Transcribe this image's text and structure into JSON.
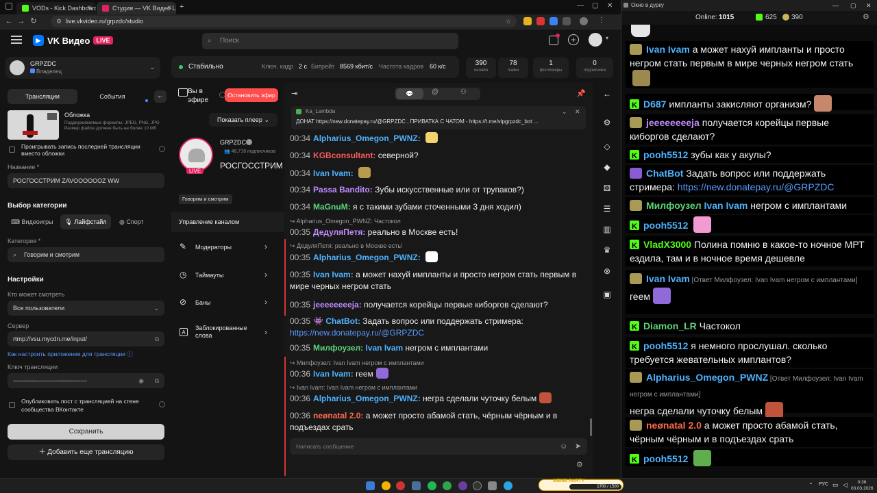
{
  "browser": {
    "tabs": [
      {
        "title": "VODs - Kick Dashboard"
      },
      {
        "title": "Студия — VK Видео Live"
      }
    ],
    "url": "live.vkvideo.ru/grpzdc/studio"
  },
  "vk": {
    "logo_text": "VK Видео",
    "live_badge": "LIVE",
    "search_placeholder": "Поиск",
    "channel": {
      "name": "GRPZDC",
      "role": "Владелец"
    },
    "left": {
      "tabs": [
        "Трансляции",
        "События"
      ],
      "cover_title": "Обложка",
      "cover_hint": "Поддерживаемые форматы: JPEG, PNG, JPG Размер файла должен быть не более 10 Мб",
      "replay_label": "Проигрывать запись последней трансляции вместо обложки",
      "name_label": "Название *",
      "name_value": "РОСГОССТРИМ ZAVOOOOOOZ WW",
      "category_section": "Выбор категории",
      "category_tabs": [
        "Видеоигры",
        "Лайфстайл",
        "Спорт"
      ],
      "category_label": "Категория *",
      "category_value": "Говорим и смотрим",
      "settings_section": "Настройки",
      "who_label": "Кто может смотреть",
      "who_value": "Все пользователи",
      "server_label": "Сервер",
      "server_value": "rtmp://vsu.mycdn.me/input/",
      "app_link": "Как настроить приложение для трансляции",
      "key_label": "Ключ трансляции",
      "key_value": "------------------------------------",
      "publish_label": "Опубликовать пост с трансляцией на стене сообщества ВКонтакте",
      "save_button": "Сохранить",
      "add_button": "Добавить еще трансляцию"
    },
    "status": {
      "state": "Стабильно",
      "keyframe_label": "Ключ. кадр",
      "keyframe_value": "2 с",
      "bitrate_label": "Битрейт",
      "bitrate_value": "8569 кбит/с",
      "fps_label": "Частота кадров",
      "fps_value": "60 к/с",
      "stats": [
        {
          "value": "390",
          "label": "онлайн"
        },
        {
          "value": "78",
          "label": "лайки"
        },
        {
          "value": "1",
          "label": "фолловеры"
        },
        {
          "value": "0",
          "label": "подписчики"
        }
      ]
    },
    "middle": {
      "on_air": "Вы в эфире",
      "stop_button": "Остановить эфир",
      "show_player": "Показать плеер",
      "channel_name": "GRPZDC",
      "subscribers": "48,716 подписчиков",
      "stream_title": "РОСГОССТРИМ ZAVOOOOOOZ WW",
      "live": "LIVE",
      "category_chip": "Говорим и смотрим",
      "manage_title": "Управление каналом",
      "menu": [
        "Модераторы",
        "Таймауты",
        "Баны",
        "Заблокированные слова"
      ]
    },
    "chat": {
      "pinned_author": "Ka_Lambda",
      "pinned_text": "ДОНАТ https://new.donatepay.ru/@GRPZDC , ПРИВАТКА С ЧАТОМ - https://t.me/vipgrpzdc_bot ...",
      "input_placeholder": "Написать сообщение",
      "messages": [
        {
          "time": "00:34",
          "author": "Alpharius_Omegon_PWNZ:",
          "text": "",
          "color": "#4fb3ff"
        },
        {
          "time": "00:34",
          "author": "KGBconsultant:",
          "text": "северной?",
          "color": "#ff5a5a"
        },
        {
          "time": "00:34",
          "author": "Ivan Ivam:",
          "text": "",
          "color": "#4fb3ff"
        },
        {
          "time": "00:34",
          "author": "Passa Bandito:",
          "text": "Зубы искусственные или от трупаков?)",
          "color": "#c08cff"
        },
        {
          "time": "00:34",
          "author": "MaGnuM:",
          "text": "я с такими зубами сточенными 3 дня ходил)",
          "color": "#5bd47a"
        },
        {
          "time": "00:35",
          "author": "ДедуляПетя:",
          "text": "реально в Москве есть!",
          "color": "#c08cff"
        },
        {
          "time": "00:35",
          "author": "Alpharius_Omegon_PWNZ:",
          "text": "",
          "color": "#4fb3ff"
        },
        {
          "time": "00:35",
          "author": "Ivan Ivam:",
          "text": "а может нахуй импланты и просто негром стать первым в мире черных негром стать",
          "color": "#4fb3ff"
        },
        {
          "time": "00:35",
          "author": "jeeeeeeeeja:",
          "text": "получается корейцы первые киборгов сделают?",
          "color": "#c08cff"
        },
        {
          "time": "00:35",
          "author": "ChatBot:",
          "text": "Задать вопрос или поддержать стримера:",
          "link": "https://new.donatepay.ru/@GRPZDC",
          "color": "#4fb3ff"
        },
        {
          "time": "00:35",
          "author": "Милфоузел:",
          "author2": "Ivan Ivam",
          "text": "негром с имплантами",
          "color": "#5bd47a"
        },
        {
          "time": "00:36",
          "author": "Ivan Ivam:",
          "text": "геем",
          "color": "#4fb3ff"
        },
        {
          "time": "00:36",
          "author": "Alpharius_Omegon_PWNZ:",
          "text": "негра сделали чуточку белым",
          "color": "#4fb3ff"
        },
        {
          "time": "00:36",
          "author": "neønatal 2.0:",
          "text": "а может просто абамой стать, чёрным чёрным и в подъездах срать",
          "color": "#ff6b4a"
        }
      ],
      "replies": [
        "Alpharius_Omegon_PWNZ: Частокол",
        "ДедуляПетя: реально в Москве есть!",
        "Милфоузел: Ivan Ivam негром с имплантами",
        "Ivan Ivam: Ivan Ivam негром с имплантами"
      ]
    }
  },
  "popout": {
    "window_title": "Окно в дурку",
    "online_label": "Online:",
    "online_value": "1015",
    "kick_count": "625",
    "vk_count": "390",
    "messages": [
      {
        "author": "Ivan Ivam",
        "text": "а может нахуй импланты и просто негром стать первым в мире черных негром стать",
        "color": "#4fb3ff",
        "src": "vk"
      },
      {
        "author": "D687",
        "text": "импланты закисляют организм?",
        "color": "#4fb3ff",
        "src": "kick"
      },
      {
        "author": "jeeeeeeeeja",
        "text": "получается корейцы первые киборгов сделают?",
        "color": "#c08cff",
        "src": "vk"
      },
      {
        "author": "pooh5512",
        "text": "зубы как у акулы?",
        "color": "#4fb3ff",
        "src": "kick"
      },
      {
        "author": "ChatBot",
        "text": "Задать вопрос или поддержать стримера:",
        "link": "https://new.donatepay.ru/@GRPZDC",
        "color": "#4fb3ff",
        "src": "bot"
      },
      {
        "author": "Милфоузел",
        "author2": "Ivan Ivam",
        "text": "негром с имплантами",
        "color": "#5bd47a",
        "src": "vk"
      },
      {
        "author": "pooh5512",
        "text": "",
        "color": "#4fb3ff",
        "src": "kick"
      },
      {
        "author": "VladX3000",
        "text": "Полина помню в какое-то ночное МРТ ездила, там и в ночное время дешевле",
        "color": "#53fc18",
        "src": "kick"
      },
      {
        "author": "Ivan Ivam",
        "reply": "[Ответ Милфоузел: Ivan Ivam негром с имплантами]",
        "text": "геем",
        "color": "#4fb3ff",
        "src": "vk"
      },
      {
        "author": "Diamon_LR",
        "text": "Частокол",
        "color": "#5bd47a",
        "src": "kick"
      },
      {
        "author": "pooh5512",
        "text": "я немного прослушал. сколько требуется жевательных имплантов?",
        "color": "#4fb3ff",
        "src": "kick"
      },
      {
        "author": "Alpharius_Omegon_PWNZ",
        "reply": "[Ответ Милфоузел: Ivan Ivam негром с имплантами]",
        "text": "негра сделали чуточку белым",
        "color": "#4fb3ff",
        "src": "vk"
      },
      {
        "author": "neønatal 2.0",
        "text": "а может просто абамой стать, чёрным чёрным и в подъездах срать",
        "color": "#ff6b4a",
        "src": "vk"
      },
      {
        "author": "pooh5512",
        "text": "",
        "color": "#4fb3ff",
        "src": "kick"
      }
    ]
  },
  "taskbar": {
    "lang": "РУС",
    "time": "0:36",
    "date": "03.03.2026",
    "widget_text": "MEME PARTY",
    "widget_counter": "1700 / 1500"
  }
}
